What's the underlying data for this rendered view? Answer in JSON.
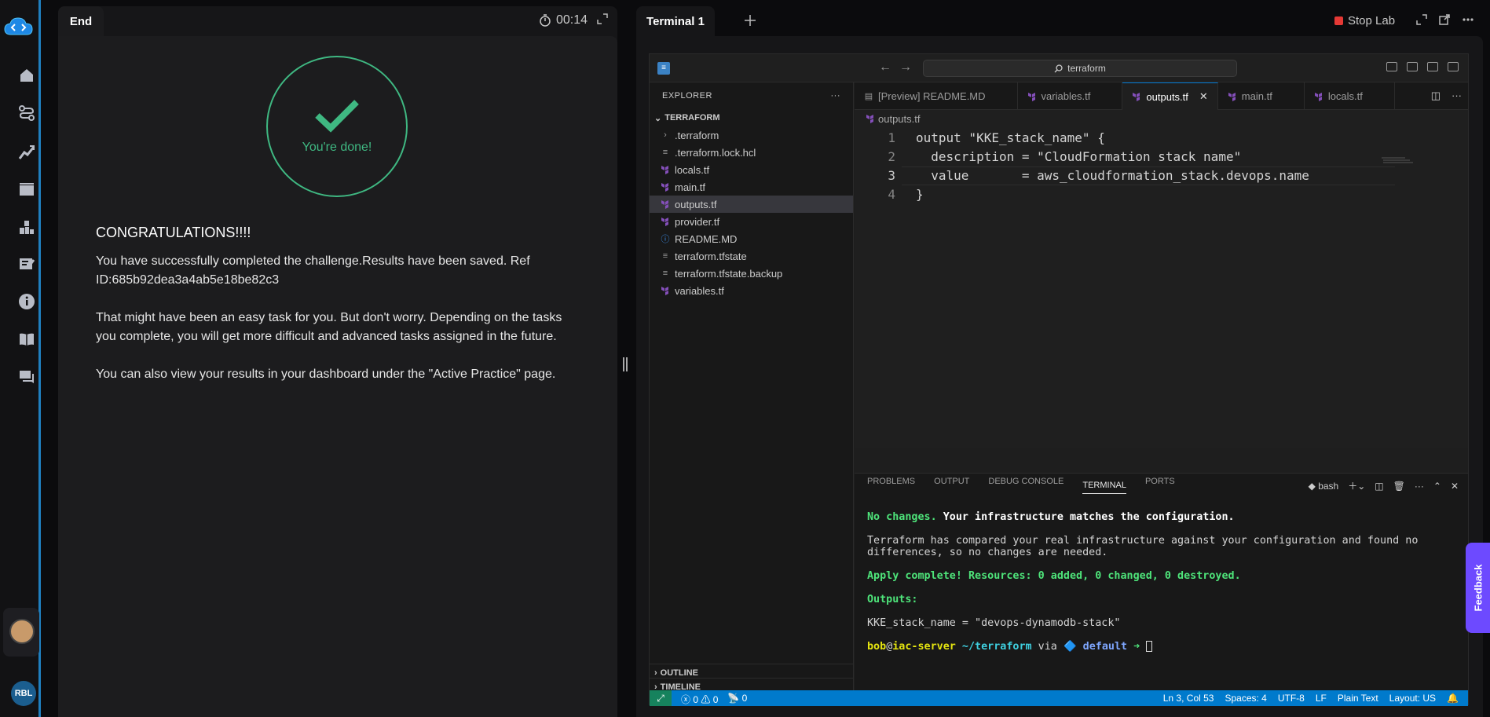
{
  "left_panel": {
    "tab_label": "End",
    "timer": "00:14",
    "done_text": "You're done!",
    "heading": "CONGRATULATIONS!!!!",
    "paragraphs": [
      "You have successfully completed the challenge.Results have been saved. Ref ID:685b92dea3a4ab5e18be82c3",
      "That might have been an easy task for you. But don't worry. Depending on the tasks you complete, you will get more difficult and advanced tasks assigned in the future.",
      "You can also view your results in your dashboard under the \"Active Practice\" page."
    ]
  },
  "rail": {
    "user_initials": "RBL"
  },
  "right_panel": {
    "tab_label": "Terminal 1",
    "stop_lab": "Stop Lab"
  },
  "vscode": {
    "search_text": "terraform",
    "explorer_title": "EXPLORER",
    "root_folder": "TERRAFORM",
    "files": [
      {
        "name": ".terraform",
        "kind": "folder"
      },
      {
        "name": ".terraform.lock.hcl",
        "kind": "text"
      },
      {
        "name": "locals.tf",
        "kind": "tf"
      },
      {
        "name": "main.tf",
        "kind": "tf"
      },
      {
        "name": "outputs.tf",
        "kind": "tf",
        "selected": true
      },
      {
        "name": "provider.tf",
        "kind": "tf"
      },
      {
        "name": "README.MD",
        "kind": "info"
      },
      {
        "name": "terraform.tfstate",
        "kind": "text"
      },
      {
        "name": "terraform.tfstate.backup",
        "kind": "text"
      },
      {
        "name": "variables.tf",
        "kind": "tf"
      }
    ],
    "outline_label": "OUTLINE",
    "timeline_label": "TIMELINE",
    "tabs": [
      {
        "label": "[Preview] README.MD",
        "active": false
      },
      {
        "label": "variables.tf",
        "active": false
      },
      {
        "label": "outputs.tf",
        "active": true
      },
      {
        "label": "main.tf",
        "active": false
      },
      {
        "label": "locals.tf",
        "active": false
      }
    ],
    "breadcrumb": "outputs.tf",
    "code_lines": [
      {
        "n": "1",
        "text": "output \"KKE_stack_name\" {"
      },
      {
        "n": "2",
        "text": "  description = \"CloudFormation stack name\""
      },
      {
        "n": "3",
        "text": "  value       = aws_cloudformation_stack.devops.name"
      },
      {
        "n": "4",
        "text": "}"
      }
    ],
    "panel_tabs": [
      "PROBLEMS",
      "OUTPUT",
      "DEBUG CONSOLE",
      "TERMINAL",
      "PORTS"
    ],
    "shell_name": "bash",
    "terminal": {
      "l1_green": "No changes.",
      "l1_white": " Your infrastructure matches the configuration.",
      "l2": "Terraform has compared your real infrastructure against your configuration and found no",
      "l3": "differences, so no changes are needed.",
      "l4": "Apply complete! Resources: 0 added, 0 changed, 0 destroyed.",
      "l5": "Outputs:",
      "l6": "KKE_stack_name = \"devops-dynamodb-stack\"",
      "prompt_user": "bob",
      "prompt_at": "@",
      "prompt_host": "iac-server",
      "prompt_path": " ~/terraform",
      "prompt_via": " via ",
      "prompt_ws": "🔷 default",
      "prompt_arrow": " ➜ "
    },
    "status": {
      "errors": "0",
      "warnings": "0",
      "ports": "0",
      "position": "Ln 3, Col 53",
      "spaces": "Spaces: 4",
      "encoding": "UTF-8",
      "eol": "LF",
      "language": "Plain Text",
      "layout": "Layout: US"
    }
  },
  "feedback_label": "Feedback",
  "colors": {
    "accent_green": "#3fb882",
    "vscode_blue": "#007acc",
    "tf_purple": "#844fba",
    "feedback": "#6d4aff"
  }
}
